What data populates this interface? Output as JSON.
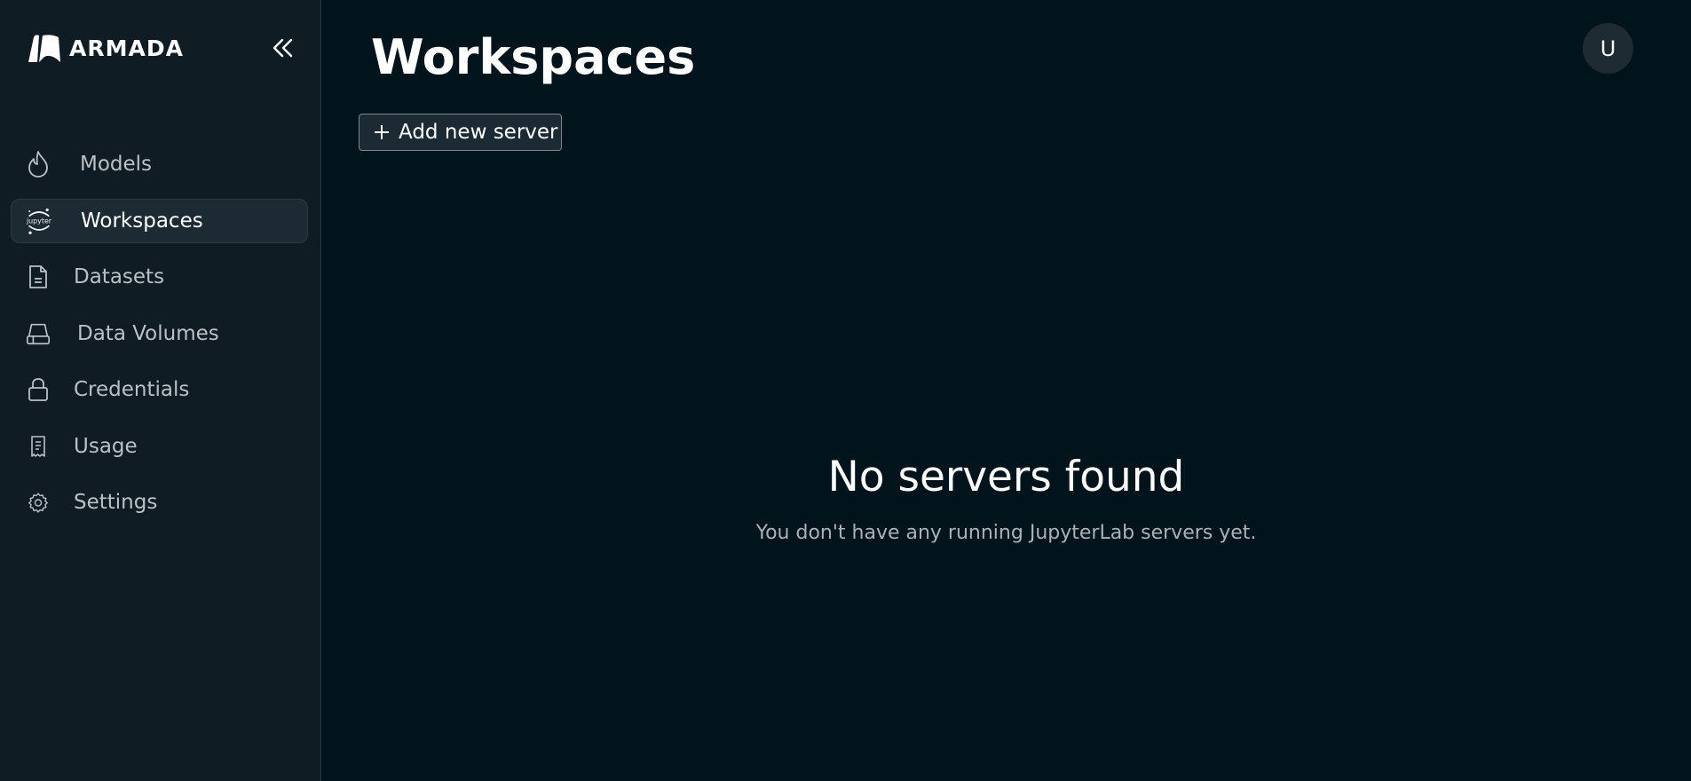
{
  "app": {
    "name": "ARMADA"
  },
  "sidebar": {
    "items": [
      {
        "label": "Models",
        "icon": "flame-icon",
        "active": false
      },
      {
        "label": "Workspaces",
        "icon": "jupyter-icon",
        "active": true,
        "icon_text": "jupyter"
      },
      {
        "label": "Datasets",
        "icon": "document-icon",
        "active": false
      },
      {
        "label": "Data Volumes",
        "icon": "drive-icon",
        "active": false
      },
      {
        "label": "Credentials",
        "icon": "lock-icon",
        "active": false
      },
      {
        "label": "Usage",
        "icon": "receipt-icon",
        "active": false
      },
      {
        "label": "Settings",
        "icon": "gear-icon",
        "active": false
      }
    ]
  },
  "header": {
    "title": "Workspaces",
    "avatar_initial": "U"
  },
  "toolbar": {
    "add_label": "Add new server"
  },
  "empty_state": {
    "title": "No servers found",
    "subtitle": "You don't have any running JupyterLab servers yet."
  },
  "colors": {
    "background": "#01141b",
    "sidebar": "#0f1c23",
    "active_item": "#1c2b33",
    "text_muted": "#b9c1c6"
  }
}
